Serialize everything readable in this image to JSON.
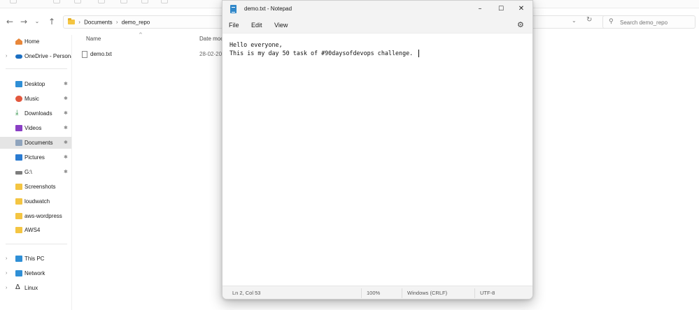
{
  "explorer": {
    "breadcrumb": [
      "Documents",
      "demo_repo"
    ],
    "search": {
      "placeholder": "Search demo_repo"
    },
    "sidebar": {
      "items": [
        {
          "label": "Home",
          "icon": "home-icon"
        },
        {
          "label": "OneDrive - Persona",
          "icon": "onedrive-icon"
        },
        {
          "label": "Desktop",
          "icon": "desktop-icon",
          "pinned": true
        },
        {
          "label": "Music",
          "icon": "music-icon",
          "pinned": true
        },
        {
          "label": "Downloads",
          "icon": "download-icon",
          "pinned": true
        },
        {
          "label": "Videos",
          "icon": "video-icon",
          "pinned": true
        },
        {
          "label": "Documents",
          "icon": "document-icon",
          "pinned": true,
          "selected": true
        },
        {
          "label": "Pictures",
          "icon": "pictures-icon",
          "pinned": true
        },
        {
          "label": "G:\\",
          "icon": "drive-icon",
          "pinned": true
        },
        {
          "label": "Screenshots",
          "icon": "folder-icon"
        },
        {
          "label": "loudwatch",
          "icon": "folder-icon"
        },
        {
          "label": "aws-wordpress",
          "icon": "folder-icon"
        },
        {
          "label": "AWS4",
          "icon": "folder-icon"
        },
        {
          "label": "This PC",
          "icon": "this-pc-icon"
        },
        {
          "label": "Network",
          "icon": "network-icon"
        },
        {
          "label": "Linux",
          "icon": "linux-icon"
        }
      ]
    },
    "columns": {
      "name": "Name",
      "date": "Date moc"
    },
    "files": [
      {
        "name": "demo.txt",
        "date": "28-02-20"
      }
    ]
  },
  "notepad": {
    "title": "demo.txt - Notepad",
    "menu": {
      "file": "File",
      "edit": "Edit",
      "view": "View"
    },
    "content": {
      "line1": "Hello everyone,",
      "line2": "This is my day 50 task of #90daysofdevops challenge."
    },
    "status": {
      "position": "Ln 2, Col 53",
      "zoom": "100%",
      "line_ending": "Windows (CRLF)",
      "encoding": "UTF-8"
    }
  },
  "colors": {
    "accent": "#2f87c9",
    "folder": "#f4c542",
    "selection": "#e5e5e5"
  }
}
